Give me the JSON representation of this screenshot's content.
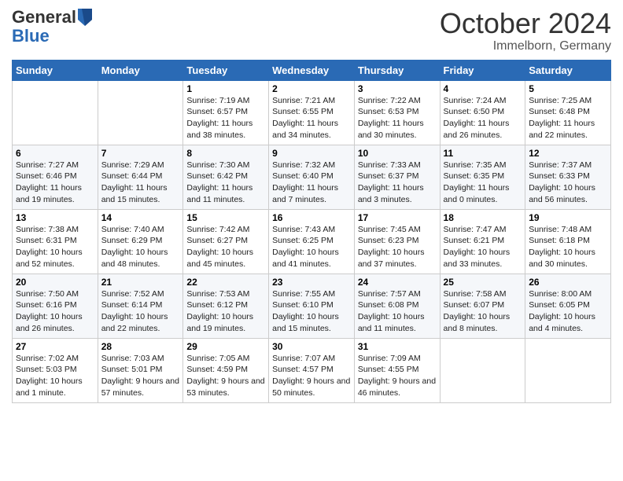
{
  "header": {
    "logo": {
      "line1": "General",
      "line2": "Blue"
    },
    "title": "October 2024",
    "location": "Immelborn, Germany"
  },
  "calendar": {
    "days_of_week": [
      "Sunday",
      "Monday",
      "Tuesday",
      "Wednesday",
      "Thursday",
      "Friday",
      "Saturday"
    ],
    "weeks": [
      [
        {
          "day": "",
          "info": ""
        },
        {
          "day": "",
          "info": ""
        },
        {
          "day": "1",
          "info": "Sunrise: 7:19 AM\nSunset: 6:57 PM\nDaylight: 11 hours and 38 minutes."
        },
        {
          "day": "2",
          "info": "Sunrise: 7:21 AM\nSunset: 6:55 PM\nDaylight: 11 hours and 34 minutes."
        },
        {
          "day": "3",
          "info": "Sunrise: 7:22 AM\nSunset: 6:53 PM\nDaylight: 11 hours and 30 minutes."
        },
        {
          "day": "4",
          "info": "Sunrise: 7:24 AM\nSunset: 6:50 PM\nDaylight: 11 hours and 26 minutes."
        },
        {
          "day": "5",
          "info": "Sunrise: 7:25 AM\nSunset: 6:48 PM\nDaylight: 11 hours and 22 minutes."
        }
      ],
      [
        {
          "day": "6",
          "info": "Sunrise: 7:27 AM\nSunset: 6:46 PM\nDaylight: 11 hours and 19 minutes."
        },
        {
          "day": "7",
          "info": "Sunrise: 7:29 AM\nSunset: 6:44 PM\nDaylight: 11 hours and 15 minutes."
        },
        {
          "day": "8",
          "info": "Sunrise: 7:30 AM\nSunset: 6:42 PM\nDaylight: 11 hours and 11 minutes."
        },
        {
          "day": "9",
          "info": "Sunrise: 7:32 AM\nSunset: 6:40 PM\nDaylight: 11 hours and 7 minutes."
        },
        {
          "day": "10",
          "info": "Sunrise: 7:33 AM\nSunset: 6:37 PM\nDaylight: 11 hours and 3 minutes."
        },
        {
          "day": "11",
          "info": "Sunrise: 7:35 AM\nSunset: 6:35 PM\nDaylight: 11 hours and 0 minutes."
        },
        {
          "day": "12",
          "info": "Sunrise: 7:37 AM\nSunset: 6:33 PM\nDaylight: 10 hours and 56 minutes."
        }
      ],
      [
        {
          "day": "13",
          "info": "Sunrise: 7:38 AM\nSunset: 6:31 PM\nDaylight: 10 hours and 52 minutes."
        },
        {
          "day": "14",
          "info": "Sunrise: 7:40 AM\nSunset: 6:29 PM\nDaylight: 10 hours and 48 minutes."
        },
        {
          "day": "15",
          "info": "Sunrise: 7:42 AM\nSunset: 6:27 PM\nDaylight: 10 hours and 45 minutes."
        },
        {
          "day": "16",
          "info": "Sunrise: 7:43 AM\nSunset: 6:25 PM\nDaylight: 10 hours and 41 minutes."
        },
        {
          "day": "17",
          "info": "Sunrise: 7:45 AM\nSunset: 6:23 PM\nDaylight: 10 hours and 37 minutes."
        },
        {
          "day": "18",
          "info": "Sunrise: 7:47 AM\nSunset: 6:21 PM\nDaylight: 10 hours and 33 minutes."
        },
        {
          "day": "19",
          "info": "Sunrise: 7:48 AM\nSunset: 6:18 PM\nDaylight: 10 hours and 30 minutes."
        }
      ],
      [
        {
          "day": "20",
          "info": "Sunrise: 7:50 AM\nSunset: 6:16 PM\nDaylight: 10 hours and 26 minutes."
        },
        {
          "day": "21",
          "info": "Sunrise: 7:52 AM\nSunset: 6:14 PM\nDaylight: 10 hours and 22 minutes."
        },
        {
          "day": "22",
          "info": "Sunrise: 7:53 AM\nSunset: 6:12 PM\nDaylight: 10 hours and 19 minutes."
        },
        {
          "day": "23",
          "info": "Sunrise: 7:55 AM\nSunset: 6:10 PM\nDaylight: 10 hours and 15 minutes."
        },
        {
          "day": "24",
          "info": "Sunrise: 7:57 AM\nSunset: 6:08 PM\nDaylight: 10 hours and 11 minutes."
        },
        {
          "day": "25",
          "info": "Sunrise: 7:58 AM\nSunset: 6:07 PM\nDaylight: 10 hours and 8 minutes."
        },
        {
          "day": "26",
          "info": "Sunrise: 8:00 AM\nSunset: 6:05 PM\nDaylight: 10 hours and 4 minutes."
        }
      ],
      [
        {
          "day": "27",
          "info": "Sunrise: 7:02 AM\nSunset: 5:03 PM\nDaylight: 10 hours and 1 minute."
        },
        {
          "day": "28",
          "info": "Sunrise: 7:03 AM\nSunset: 5:01 PM\nDaylight: 9 hours and 57 minutes."
        },
        {
          "day": "29",
          "info": "Sunrise: 7:05 AM\nSunset: 4:59 PM\nDaylight: 9 hours and 53 minutes."
        },
        {
          "day": "30",
          "info": "Sunrise: 7:07 AM\nSunset: 4:57 PM\nDaylight: 9 hours and 50 minutes."
        },
        {
          "day": "31",
          "info": "Sunrise: 7:09 AM\nSunset: 4:55 PM\nDaylight: 9 hours and 46 minutes."
        },
        {
          "day": "",
          "info": ""
        },
        {
          "day": "",
          "info": ""
        }
      ]
    ]
  }
}
